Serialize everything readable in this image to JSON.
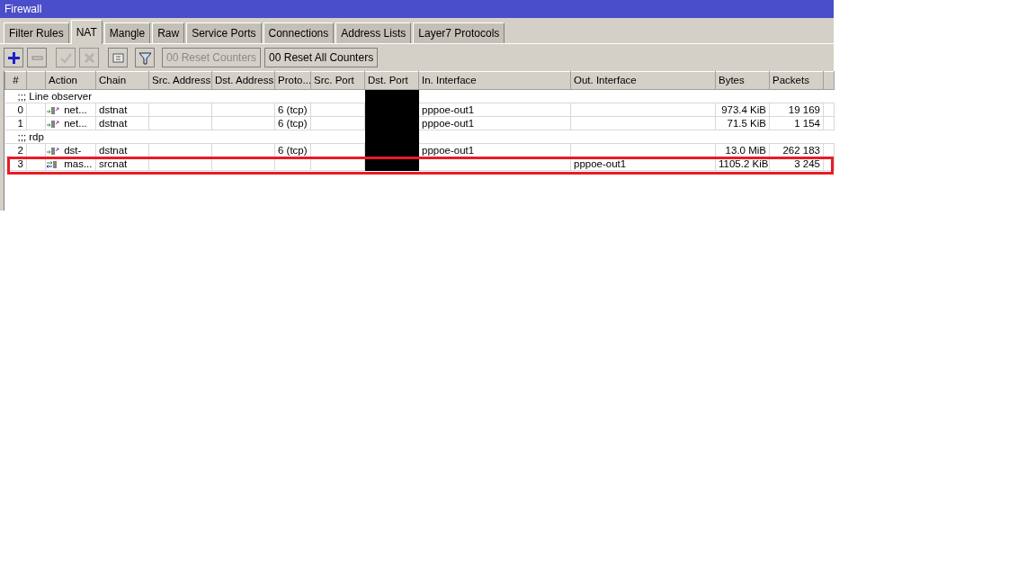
{
  "window": {
    "title": "Firewall"
  },
  "tabs": [
    {
      "label": "Filter Rules",
      "selected": false
    },
    {
      "label": "NAT",
      "selected": true
    },
    {
      "label": "Mangle",
      "selected": false
    },
    {
      "label": "Raw",
      "selected": false
    },
    {
      "label": "Service Ports",
      "selected": false
    },
    {
      "label": "Connections",
      "selected": false
    },
    {
      "label": "Address Lists",
      "selected": false
    },
    {
      "label": "Layer7 Protocols",
      "selected": false
    }
  ],
  "toolbar": {
    "buttons": [
      {
        "kind": "add",
        "disabled": false
      },
      {
        "kind": "remove",
        "disabled": false
      },
      {
        "kind": "enable",
        "disabled": true
      },
      {
        "kind": "disable",
        "disabled": true
      },
      {
        "kind": "comment",
        "disabled": false
      },
      {
        "kind": "filter",
        "disabled": false
      }
    ],
    "counter_buttons": [
      {
        "prefix": "00",
        "label": "Reset Counters",
        "disabled": true
      },
      {
        "prefix": "00",
        "label": "Reset All Counters",
        "disabled": false
      }
    ]
  },
  "table": {
    "columns": [
      "#",
      "Action",
      "Chain",
      "Src. Address",
      "Dst. Address",
      "Proto...",
      "Src. Port",
      "Dst. Port",
      "In. Interface",
      "Out. Interface",
      "Bytes",
      "Packets"
    ],
    "rows": [
      {
        "kind": "comment",
        "text": ";;; Line observer",
        "redacted": true
      },
      {
        "kind": "dst-nat",
        "number": "0",
        "action": "net...",
        "chain": "dstnat",
        "protocol": "6 (tcp)",
        "in_interface": "pppoe-out1",
        "bytes": "973.4 KiB",
        "packets": "19 169",
        "redacted": true,
        "highlighted": false
      },
      {
        "kind": "dst-nat",
        "number": "1",
        "action": "net...",
        "chain": "dstnat",
        "protocol": "6 (tcp)",
        "in_interface": "pppoe-out1",
        "bytes": "71.5 KiB",
        "packets": "1 154",
        "redacted": true,
        "highlighted": false
      },
      {
        "kind": "comment",
        "text": ";;; rdp",
        "redacted": true
      },
      {
        "kind": "dst-nat",
        "number": "2",
        "action": "dst-",
        "chain": "dstnat",
        "protocol": "6 (tcp)",
        "in_interface": "pppoe-out1",
        "bytes": "13.0 MiB",
        "packets": "262 183",
        "redacted": true,
        "highlighted": false
      },
      {
        "kind": "masquerade",
        "number": "3",
        "action": "mas...",
        "chain": "srcnat",
        "out_interface": "pppoe-out1",
        "bytes": "1105.2 KiB",
        "packets": "3 245",
        "redacted": true,
        "highlighted": true
      }
    ]
  }
}
